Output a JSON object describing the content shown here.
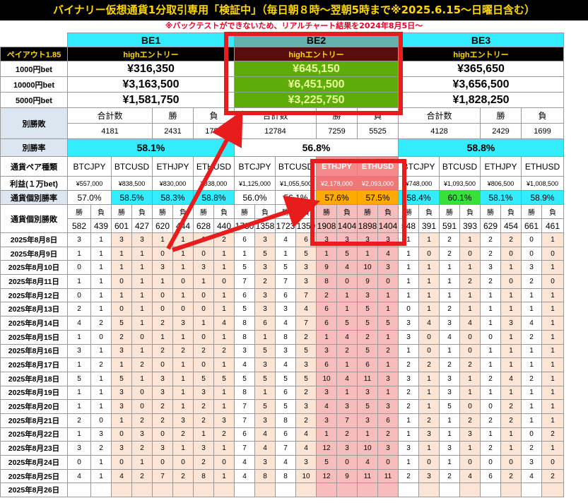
{
  "title": "バイナリー仮想通貨1分取引専用「検証中」（毎日朝８時〜翌朝5時まで※2025.6.15〜日曜日含む）",
  "subtitle": "※バックテストができないため、リアルチャート結果を2024年8月5日〜",
  "row_labels": {
    "payout": "ペイアウト1.85",
    "bet1000": "1000円bet",
    "bet10000": "10000円bet",
    "bet5000": "5000円bet",
    "record": "別勝敗",
    "winrate": "別勝率",
    "pair_type": "通貨ペア種類",
    "profit": "利益(１万bet)",
    "pair_rate": "通貨個別勝率",
    "pair_record": "通貨個別勝敗"
  },
  "labels": {
    "total": "合計数",
    "win": "勝",
    "loss": "負",
    "entry": "highエントリー"
  },
  "strategies": [
    {
      "name": "BE1",
      "bet1000": "¥316,350",
      "bet10000": "¥3,163,500",
      "bet5000": "¥1,581,750",
      "total": "4181",
      "wins": "2431",
      "losses": "1750",
      "winrate": "58.1%",
      "pairs": [
        {
          "name": "BTCJPY",
          "profit": "¥557,000",
          "rate": "57.0%",
          "w": "582",
          "l": "439"
        },
        {
          "name": "BTCUSD",
          "profit": "¥838,500",
          "rate": "58.5%",
          "w": "601",
          "l": "427"
        },
        {
          "name": "ETHJPY",
          "profit": "¥830,000",
          "rate": "58.3%",
          "w": "620",
          "l": "444"
        },
        {
          "name": "ETHUSD",
          "profit": "¥938,000",
          "rate": "58.8%",
          "w": "628",
          "l": "440"
        }
      ]
    },
    {
      "name": "BE2",
      "bet1000": "¥645,150",
      "bet10000": "¥6,451,500",
      "bet5000": "¥3,225,750",
      "total": "12784",
      "wins": "7259",
      "losses": "5525",
      "winrate": "56.8%",
      "pairs": [
        {
          "name": "BTCJPY",
          "profit": "¥1,125,000",
          "rate": "56.0%",
          "w": "1730",
          "l": "1358"
        },
        {
          "name": "BTCUSD",
          "profit": "¥1,055,500",
          "rate": "56.1%",
          "w": "1723",
          "l": "1359"
        },
        {
          "name": "ETHJPY",
          "profit": "¥2,178,000",
          "rate": "57.6%",
          "w": "1908",
          "l": "1404"
        },
        {
          "name": "ETHUSD",
          "profit": "¥2,093,000",
          "rate": "57.5%",
          "w": "1898",
          "l": "1404"
        }
      ]
    },
    {
      "name": "BE3",
      "bet1000": "¥365,650",
      "bet10000": "¥3,656,500",
      "bet5000": "¥1,828,250",
      "total": "4128",
      "wins": "2429",
      "losses": "1699",
      "winrate": "58.8%",
      "pairs": [
        {
          "name": "BTCJPY",
          "profit": "¥748,000",
          "rate": "58.4%",
          "w": "548",
          "l": "391"
        },
        {
          "name": "BTCUSD",
          "profit": "¥1,093,500",
          "rate": "60.1%",
          "w": "591",
          "l": "393"
        },
        {
          "name": "ETHJPY",
          "profit": "¥806,500",
          "rate": "58.1%",
          "w": "629",
          "l": "454"
        },
        {
          "name": "ETHUSD",
          "profit": "¥1,008,500",
          "rate": "58.9%",
          "w": "661",
          "l": "461"
        }
      ]
    }
  ],
  "days": [
    {
      "date": "2025年8月8日",
      "v": [
        "3",
        "1",
        "3",
        "3",
        "1",
        "1",
        "1",
        "2",
        "6",
        "3",
        "4",
        "6",
        "3",
        "3",
        "3",
        "3",
        "1",
        "1",
        "2",
        "1",
        "2",
        "2",
        "0",
        "1"
      ]
    },
    {
      "date": "2025年8月9日",
      "v": [
        "1",
        "1",
        "1",
        "1",
        "0",
        "1",
        "0",
        "1",
        "1",
        "5",
        "1",
        "5",
        "1",
        "5",
        "1",
        "4",
        "1",
        "0",
        "2",
        "0",
        "2",
        "0",
        "0",
        "0"
      ]
    },
    {
      "date": "2025年8月10日",
      "v": [
        "0",
        "1",
        "1",
        "1",
        "3",
        "1",
        "3",
        "1",
        "5",
        "3",
        "5",
        "3",
        "9",
        "4",
        "10",
        "3",
        "1",
        "1",
        "1",
        "1",
        "3",
        "1",
        "3",
        "1"
      ]
    },
    {
      "date": "2025年8月11日",
      "v": [
        "1",
        "1",
        "0",
        "1",
        "1",
        "0",
        "1",
        "0",
        "7",
        "2",
        "7",
        "3",
        "8",
        "0",
        "9",
        "0",
        "1",
        "1",
        "1",
        "2",
        "2",
        "0",
        "2",
        "0"
      ]
    },
    {
      "date": "2025年8月12日",
      "v": [
        "0",
        "1",
        "1",
        "1",
        "0",
        "1",
        "0",
        "1",
        "6",
        "3",
        "6",
        "7",
        "2",
        "1",
        "3",
        "1",
        "1",
        "1",
        "1",
        "1",
        "1",
        "1",
        "1",
        "1"
      ]
    },
    {
      "date": "2025年8月13日",
      "v": [
        "2",
        "1",
        "0",
        "1",
        "0",
        "0",
        "0",
        "1",
        "5",
        "3",
        "3",
        "4",
        "6",
        "1",
        "5",
        "1",
        "0",
        "1",
        "2",
        "1",
        "1",
        "1",
        "1",
        "1"
      ]
    },
    {
      "date": "2025年8月14日",
      "v": [
        "4",
        "2",
        "5",
        "1",
        "2",
        "3",
        "1",
        "4",
        "8",
        "6",
        "4",
        "7",
        "6",
        "5",
        "5",
        "5",
        "3",
        "4",
        "3",
        "4",
        "1",
        "3",
        "4",
        "1"
      ]
    },
    {
      "date": "2025年8月15日",
      "v": [
        "1",
        "0",
        "2",
        "0",
        "1",
        "1",
        "0",
        "1",
        "8",
        "1",
        "8",
        "2",
        "1",
        "4",
        "2",
        "1",
        "3",
        "0",
        "4",
        "0",
        "0",
        "1",
        "2",
        "1"
      ]
    },
    {
      "date": "2025年8月16日",
      "v": [
        "3",
        "1",
        "3",
        "1",
        "2",
        "2",
        "2",
        "2",
        "3",
        "5",
        "3",
        "5",
        "3",
        "2",
        "5",
        "2",
        "1",
        "0",
        "1",
        "0",
        "1",
        "1",
        "1",
        "1"
      ]
    },
    {
      "date": "2025年8月17日",
      "v": [
        "1",
        "2",
        "1",
        "2",
        "0",
        "1",
        "0",
        "1",
        "4",
        "3",
        "4",
        "3",
        "6",
        "1",
        "6",
        "1",
        "2",
        "2",
        "2",
        "2",
        "1",
        "1",
        "1",
        "1"
      ]
    },
    {
      "date": "2025年8月18日",
      "v": [
        "5",
        "1",
        "5",
        "1",
        "3",
        "1",
        "5",
        "5",
        "5",
        "5",
        "5",
        "5",
        "10",
        "4",
        "11",
        "3",
        "3",
        "1",
        "3",
        "1",
        "2",
        "4",
        "2",
        "1"
      ]
    },
    {
      "date": "2025年8月19日",
      "v": [
        "1",
        "1",
        "3",
        "0",
        "3",
        "1",
        "3",
        "1",
        "8",
        "1",
        "6",
        "2",
        "3",
        "1",
        "3",
        "1",
        "2",
        "1",
        "3",
        "1",
        "1",
        "1",
        "1",
        "1"
      ]
    },
    {
      "date": "2025年8月20日",
      "v": [
        "1",
        "1",
        "3",
        "0",
        "2",
        "1",
        "2",
        "1",
        "7",
        "5",
        "5",
        "3",
        "4",
        "3",
        "5",
        "3",
        "2",
        "1",
        "5",
        "0",
        "0",
        "2",
        "1",
        "1"
      ]
    },
    {
      "date": "2025年8月21日",
      "v": [
        "2",
        "0",
        "1",
        "2",
        "2",
        "3",
        "2",
        "3",
        "7",
        "3",
        "8",
        "2",
        "3",
        "7",
        "3",
        "6",
        "1",
        "2",
        "1",
        "2",
        "2",
        "2",
        "1",
        "1"
      ]
    },
    {
      "date": "2025年8月22日",
      "v": [
        "1",
        "3",
        "0",
        "3",
        "0",
        "2",
        "1",
        "2",
        "6",
        "4",
        "6",
        "4",
        "1",
        "2",
        "1",
        "2",
        "1",
        "3",
        "1",
        "3",
        "1",
        "1",
        "0",
        "2"
      ]
    },
    {
      "date": "2025年8月23日",
      "v": [
        "3",
        "2",
        "3",
        "2",
        "3",
        "1",
        "3",
        "1",
        "7",
        "4",
        "7",
        "4",
        "12",
        "3",
        "10",
        "3",
        "3",
        "1",
        "3",
        "1",
        "2",
        "1",
        "2",
        "1"
      ]
    },
    {
      "date": "2025年8月24日",
      "v": [
        "0",
        "1",
        "0",
        "1",
        "0",
        "0",
        "2",
        "0",
        "4",
        "3",
        "4",
        "3",
        "5",
        "0",
        "4",
        "0",
        "1",
        "0",
        "1",
        "0",
        "0",
        "0",
        "3",
        "0"
      ]
    },
    {
      "date": "2025年8月25日",
      "v": [
        "4",
        "1",
        "4",
        "2",
        "7",
        "2",
        "8",
        "1",
        "4",
        "8",
        "8",
        "10",
        "12",
        "9",
        "11",
        "11",
        "2",
        "3",
        "2",
        "4",
        "6",
        "2",
        "4",
        "2"
      ]
    },
    {
      "date": "2025年8月26日",
      "v": [
        "",
        "",
        "",
        "",
        "",
        "",
        "",
        "",
        "",
        "",
        "",
        "",
        "",
        "",
        "",
        "",
        "",
        "",
        "",
        "",
        "",
        "",
        "",
        ""
      ]
    }
  ]
}
